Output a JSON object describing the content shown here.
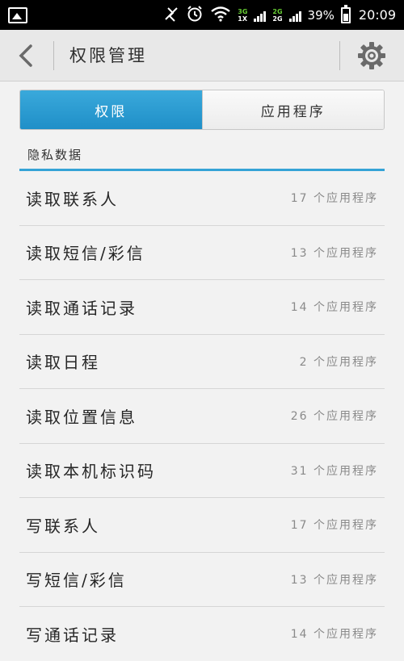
{
  "status_bar": {
    "network_top": "3G",
    "network_bottom": "1X",
    "network_top2": "2G",
    "network_bottom2": "2G",
    "battery": "39%",
    "time": "20:09"
  },
  "header": {
    "title": "权限管理",
    "back_icon": "chevron-left-icon",
    "settings_icon": "gear-icon"
  },
  "tabs": [
    {
      "label": "权限",
      "active": true
    },
    {
      "label": "应用程序",
      "active": false
    }
  ],
  "section": {
    "title": "隐私数据"
  },
  "permissions": [
    {
      "label": "读取联系人",
      "count": "17 个应用程序"
    },
    {
      "label": "读取短信/彩信",
      "count": "13 个应用程序"
    },
    {
      "label": "读取通话记录",
      "count": "14 个应用程序"
    },
    {
      "label": "读取日程",
      "count": "2 个应用程序"
    },
    {
      "label": "读取位置信息",
      "count": "26 个应用程序"
    },
    {
      "label": "读取本机标识码",
      "count": "31 个应用程序"
    },
    {
      "label": "写联系人",
      "count": "17 个应用程序"
    },
    {
      "label": "写短信/彩信",
      "count": "13 个应用程序"
    },
    {
      "label": "写通话记录",
      "count": "14 个应用程序"
    }
  ],
  "colors": {
    "accent": "#2a9bd3",
    "status_bar": "#000000",
    "title_bar": "#e8e8e8"
  }
}
